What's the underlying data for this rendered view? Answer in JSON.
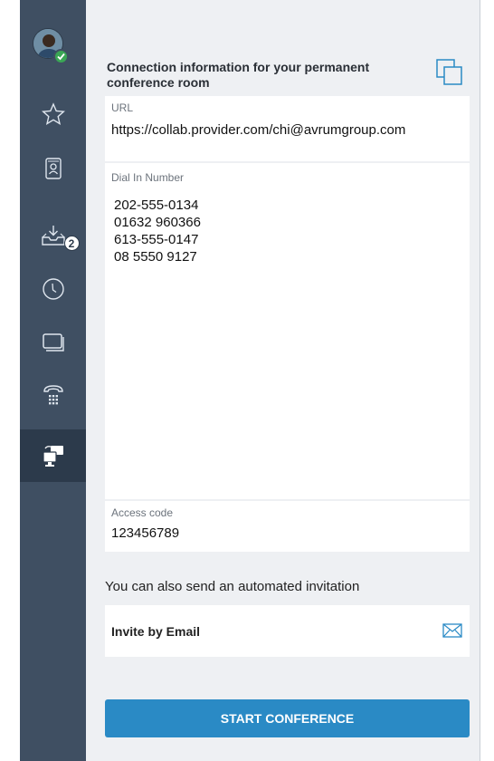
{
  "sidebar": {
    "avatar": {
      "status": "available"
    },
    "items": [
      {
        "icon": "star-icon"
      },
      {
        "icon": "contacts-icon"
      },
      {
        "icon": "inbox-tray-icon",
        "badge": "2"
      },
      {
        "icon": "clock-icon"
      },
      {
        "icon": "windows-icon"
      },
      {
        "icon": "phone-dialpad-icon"
      },
      {
        "icon": "conference-icon",
        "active": true
      }
    ]
  },
  "panel": {
    "title": "Connection information for your permanent conference room",
    "url_label": "URL",
    "url_value": "https://collab.provider.com/chi@avrumgroup.com",
    "dial_label": "Dial In Number",
    "dial_numbers": [
      "202-555-0134",
      "01632 960366",
      "613-555-0147",
      "08 5550 9127"
    ],
    "access_label": "Access code",
    "access_value": "123456789",
    "invitation_text": "You can also send an automated invitation",
    "invite_email_label": "Invite by Email",
    "start_button": "START CONFERENCE"
  },
  "colors": {
    "sidebar_bg": "#3f4f62",
    "sidebar_active": "#2c3a4b",
    "panel_bg": "#eef0f3",
    "accent": "#2a8ac5",
    "presence_green": "#3aa655"
  }
}
